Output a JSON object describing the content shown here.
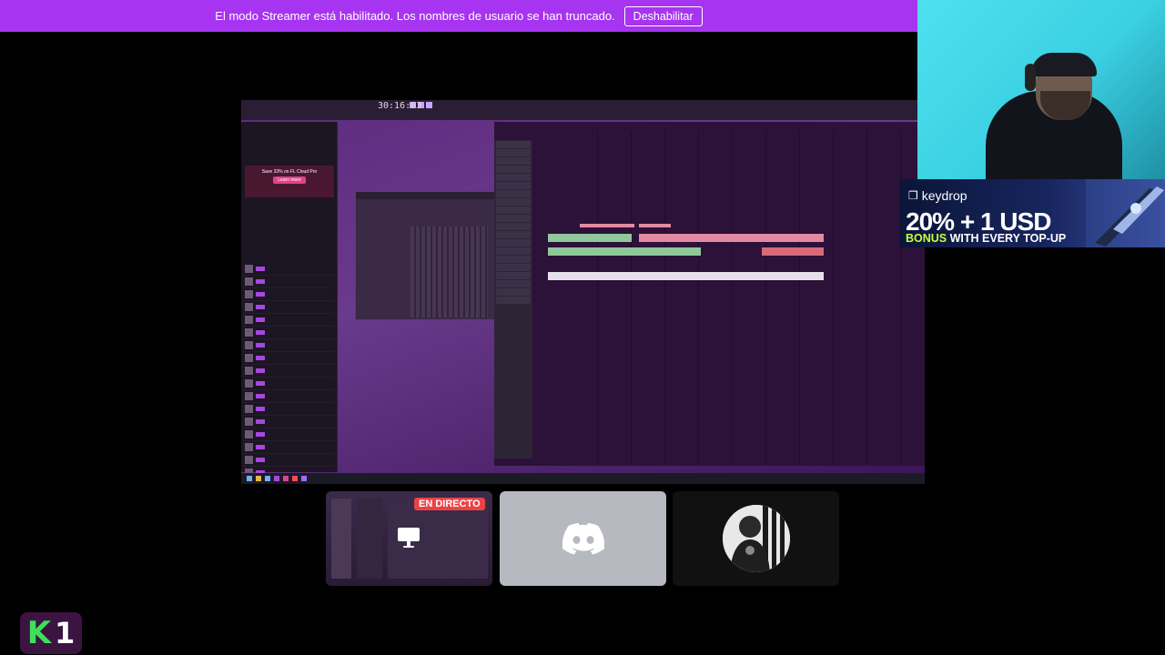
{
  "banner": {
    "message": "El modo Streamer está habilitado. Los nombres de usuario se han truncado.",
    "button_label": "Deshabilitar"
  },
  "screen_share": {
    "bpm": "30:16:03",
    "browser_ad_text": "Save 33% on FL Cloud Pro",
    "browser_ad_button": "Learn more"
  },
  "ad": {
    "brand": "keydrop",
    "headline": "20% + 1 USD",
    "sub_accent": "BONUS",
    "sub_rest": " WITH EVERY TOP-UP"
  },
  "tiles": {
    "live_badge": "EN DIRECTO"
  },
  "logo": {
    "letter": "K",
    "number": "1"
  },
  "colors": {
    "banner": "#a634f0",
    "live": "#ed4245",
    "discord_tile": "#b7b9c0",
    "ad_accent": "#c8ff3c",
    "logo_green": "#3ee05a"
  }
}
